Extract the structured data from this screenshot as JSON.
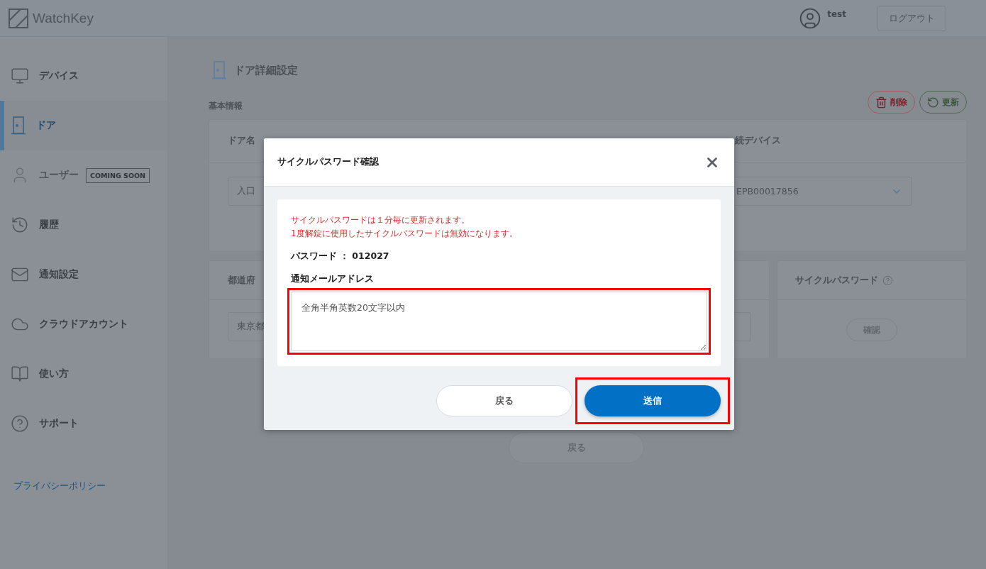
{
  "header": {
    "logo": "WatchKey",
    "user": "test",
    "logout": "ログアウト"
  },
  "sidebar": {
    "items": [
      {
        "kind": "devices",
        "label": "デバイス",
        "selected": false,
        "disabled": false
      },
      {
        "kind": "door",
        "label": "ドア",
        "selected": true,
        "disabled": false
      },
      {
        "kind": "user",
        "label": "ユーザー",
        "selected": false,
        "disabled": true,
        "badge": "COMING SOON"
      },
      {
        "kind": "history",
        "label": "履歴",
        "selected": false,
        "disabled": false
      },
      {
        "kind": "notify",
        "label": "通知設定",
        "selected": false,
        "disabled": false
      },
      {
        "kind": "cloud",
        "label": "クラウドアカウント",
        "selected": false,
        "disabled": false
      },
      {
        "kind": "guide",
        "label": "使い方",
        "selected": false,
        "disabled": false
      },
      {
        "kind": "support",
        "label": "サポート",
        "selected": false,
        "disabled": false
      }
    ],
    "footer_link": "プライバシーポリシー"
  },
  "page": {
    "title": "ドア詳細設定",
    "section": "基本情報",
    "actions": [
      {
        "kind": "delete",
        "label": "削除"
      },
      {
        "kind": "refresh",
        "label": "更新"
      }
    ],
    "card_1": {
      "label_1": "ドア名",
      "value_1": "入口",
      "label_2": "続デバイス",
      "value_2": "EPB00017856"
    },
    "card_2": {
      "label_1": "都道府",
      "value_1": "東京都"
    },
    "card_3": {
      "label": "サイクルパスワード",
      "button": "確認"
    },
    "back": "戻る"
  },
  "modal": {
    "title": "サイクルパスワード確認",
    "notice": [
      "サイクルパスワードは１分毎に更新されます。",
      "1度解錠に使用したサイクルパスワードは無効になります。"
    ],
    "password_label": "パスワード ：",
    "password": "012027",
    "field_label": "通知メールアドレス",
    "placeholder": "全角半角英数20文字以内",
    "field_highlighted": true,
    "buttons": [
      {
        "kind": "secondary",
        "label": "戻る",
        "highlighted": false
      },
      {
        "kind": "primary",
        "label": "送信",
        "highlighted": true
      }
    ]
  }
}
